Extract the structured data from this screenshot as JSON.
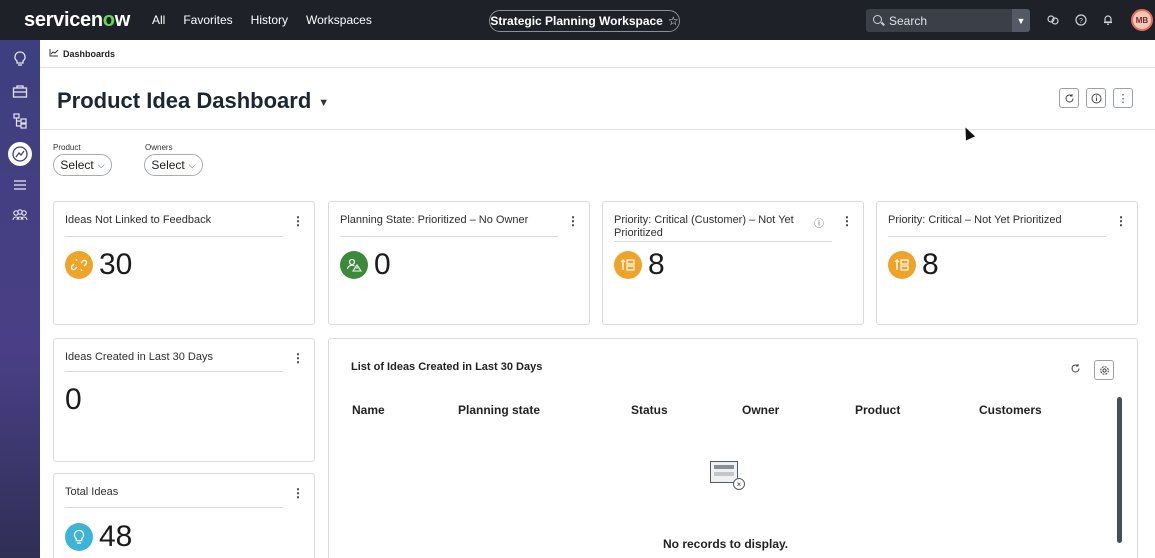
{
  "topbar": {
    "logo_prefix": "servicen",
    "logo_o": "o",
    "logo_suffix": "w",
    "nav": [
      "All",
      "Favorites",
      "History",
      "Workspaces"
    ],
    "workspace": "Strategic Planning Workspace",
    "workspace_star": "☆",
    "search_placeholder": "Search",
    "avatar": "MB",
    "icons": [
      "search-icon",
      "chat-icon",
      "help-icon",
      "bell-icon"
    ]
  },
  "breadcrumb": {
    "label": "Dashboards"
  },
  "page": {
    "title": "Product Idea Dashboard",
    "header_buttons": [
      "refresh-icon",
      "info-icon",
      "more-icon"
    ]
  },
  "filters": {
    "product": {
      "label": "Product",
      "value": "Select"
    },
    "owners": {
      "label": "Owners",
      "value": "Select"
    }
  },
  "cards": {
    "not_linked": {
      "title": "Ideas Not Linked to Feedback",
      "value": "30",
      "icon_color": "#f0a329"
    },
    "no_owner": {
      "title": "Planning State: Prioritized – No Owner",
      "value": "0",
      "icon_color": "#3a8a3a"
    },
    "critical_customer": {
      "title": "Priority: Critical (Customer) – Not Yet Prioritized",
      "value": "8",
      "icon_color": "#f0a329"
    },
    "critical": {
      "title": "Priority: Critical – Not Yet Prioritized",
      "value": "8",
      "icon_color": "#f0a329"
    },
    "last_30": {
      "title": "Ideas Created in Last 30 Days",
      "value": "0"
    },
    "total": {
      "title": "Total Ideas",
      "value": "48",
      "icon_color": "#3db3d8"
    }
  },
  "list": {
    "title": "List of Ideas Created in Last 30 Days",
    "columns": [
      "Name",
      "Planning state",
      "Status",
      "Owner",
      "Product",
      "Customers"
    ],
    "empty_message": "No records to display."
  },
  "colors": {
    "topbar_bg": "#1e2128",
    "rail_bg": "#3d3f7e",
    "accent_green": "#62d84e"
  }
}
